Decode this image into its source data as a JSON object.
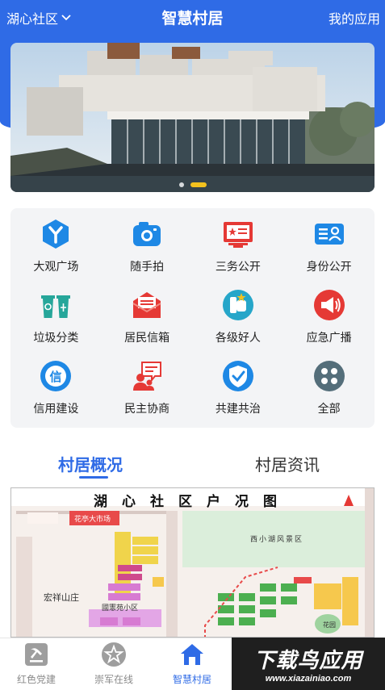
{
  "header": {
    "location": "湖心社区",
    "title": "智慧村居",
    "my_apps": "我的应用"
  },
  "banner": {
    "slides": 2,
    "active_slide": 2
  },
  "grid": [
    {
      "label": "大观广场",
      "icon": "fork-icon",
      "color": "#1e88e5"
    },
    {
      "label": "随手拍",
      "icon": "camera-icon",
      "color": "#1e88e5"
    },
    {
      "label": "三务公开",
      "icon": "notice-board-icon",
      "color": "#e53935"
    },
    {
      "label": "身份公开",
      "icon": "id-card-icon",
      "color": "#1e88e5"
    },
    {
      "label": "垃圾分类",
      "icon": "trash-bins-icon",
      "color": "#26a69a"
    },
    {
      "label": "居民信箱",
      "icon": "mail-icon",
      "color": "#e53935"
    },
    {
      "label": "各级好人",
      "icon": "award-icon",
      "color": "#26a6c9"
    },
    {
      "label": "应急广播",
      "icon": "megaphone-icon",
      "color": "#e53935"
    },
    {
      "label": "信用建设",
      "icon": "credit-icon",
      "color": "#1e88e5"
    },
    {
      "label": "民主协商",
      "icon": "discussion-icon",
      "color": "#e53935"
    },
    {
      "label": "共建共治",
      "icon": "shield-check-icon",
      "color": "#1e88e5"
    },
    {
      "label": "全部",
      "icon": "grid-all-icon",
      "color": "#546e7a"
    }
  ],
  "tabs": {
    "active": "村居概况",
    "inactive": "村居资讯"
  },
  "map": {
    "title": "湖心社区户况图",
    "labels": [
      "花亭大市场",
      "西小湖风景区",
      "宏祥山庄",
      "國憲苑小区",
      "花园"
    ]
  },
  "tabbar": [
    {
      "label": "红色党建",
      "icon": "party-icon",
      "active": false
    },
    {
      "label": "崇军在线",
      "icon": "star-badge-icon",
      "active": false
    },
    {
      "label": "智慧村居",
      "icon": "home-icon",
      "active": true
    }
  ],
  "watermark": {
    "line1": "下载鸟应用",
    "line2": "www.xiazainiao.com"
  },
  "colors": {
    "primary": "#2f6be6",
    "accent": "#f4c21e"
  }
}
